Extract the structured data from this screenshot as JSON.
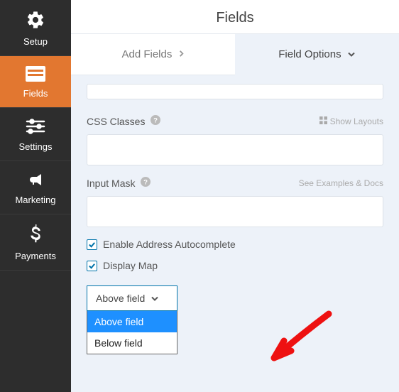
{
  "header": {
    "title": "Fields"
  },
  "sidebar": {
    "items": [
      {
        "label": "Setup"
      },
      {
        "label": "Fields"
      },
      {
        "label": "Settings"
      },
      {
        "label": "Marketing"
      },
      {
        "label": "Payments"
      }
    ]
  },
  "tabs": {
    "add": "Add Fields",
    "options": "Field Options"
  },
  "form": {
    "css_label": "CSS Classes",
    "show_layouts": "Show Layouts",
    "mask_label": "Input Mask",
    "see_examples": "See Examples & Docs",
    "autocomplete": "Enable Address Autocomplete",
    "display_map": "Display Map",
    "select_value": "Above field",
    "options": [
      "Above field",
      "Below field"
    ]
  }
}
